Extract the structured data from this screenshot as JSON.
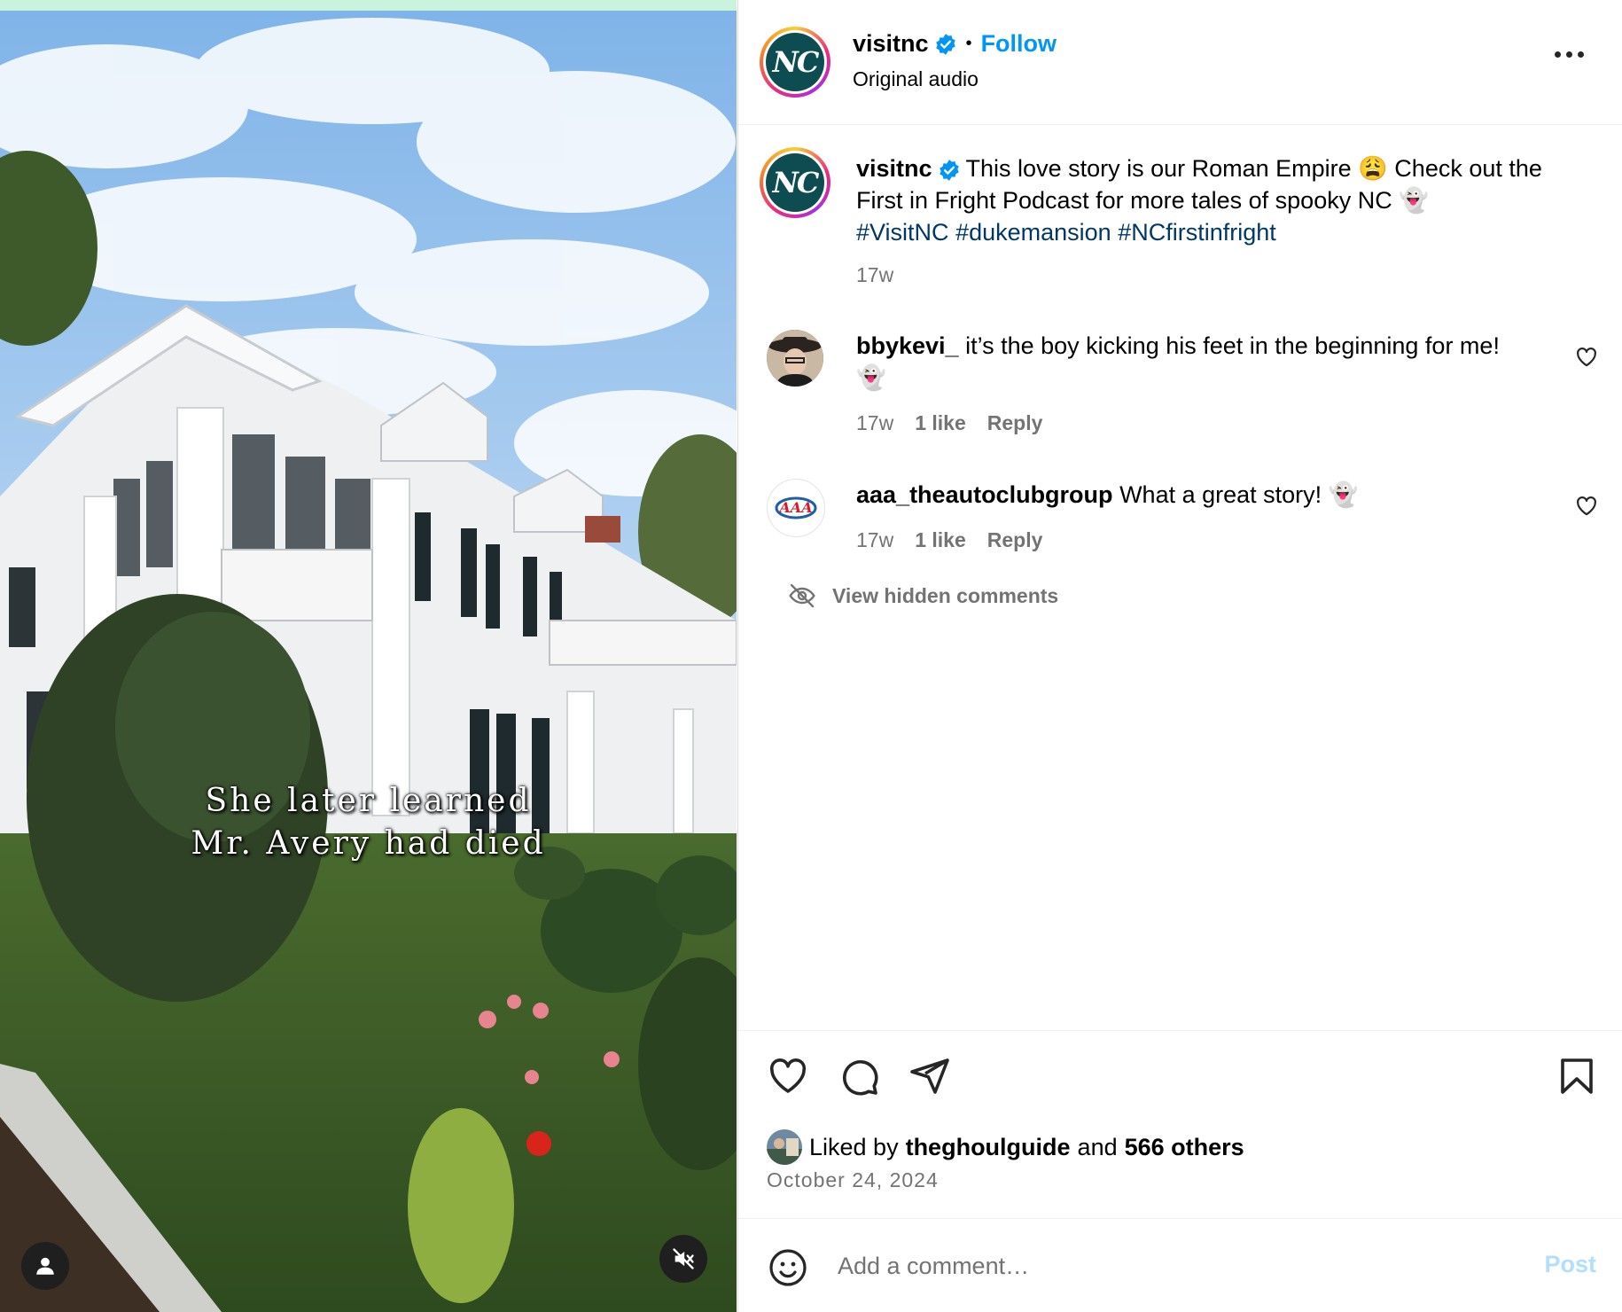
{
  "media": {
    "overlay_line1": "She later learned",
    "overlay_line2": "Mr. Avery had died",
    "user_tag_icon": "person-icon",
    "mute_icon": "speaker-muted-icon"
  },
  "header": {
    "username": "visitnc",
    "avatar_text": "NC",
    "separator": "•",
    "follow_label": "Follow",
    "audio_label": "Original audio"
  },
  "caption": {
    "username": "visitnc",
    "text_part1": "This love story is our Roman Empire 😩 Check out the First in Fright Podcast for more tales of spooky NC 👻",
    "hashtag1": "#VisitNC",
    "hashtag2": "#dukemansion",
    "hashtag3": "#NCfirstinfright",
    "time": "17w"
  },
  "comments": [
    {
      "username": "bbykevi_",
      "text": "it’s the boy kicking his feet in the beginning for me! 👻",
      "time": "17w",
      "likes": "1 like",
      "reply": "Reply"
    },
    {
      "username": "aaa_theautoclubgroup",
      "text": "What a great story! 👻",
      "time": "17w",
      "likes": "1 like",
      "reply": "Reply",
      "avatar_text": "AAA"
    }
  ],
  "hidden_comments_label": "View hidden comments",
  "likes": {
    "prefix": "Liked by",
    "user": "theghoulguide",
    "middle": "and",
    "others": "566 others"
  },
  "date": "October 24, 2024",
  "comment_box": {
    "placeholder": "Add a comment…",
    "post_label": "Post"
  },
  "colors": {
    "accent": "#0095f6",
    "hashtag": "#00376b",
    "muted": "#737373",
    "brand_teal": "#0d4d52"
  }
}
